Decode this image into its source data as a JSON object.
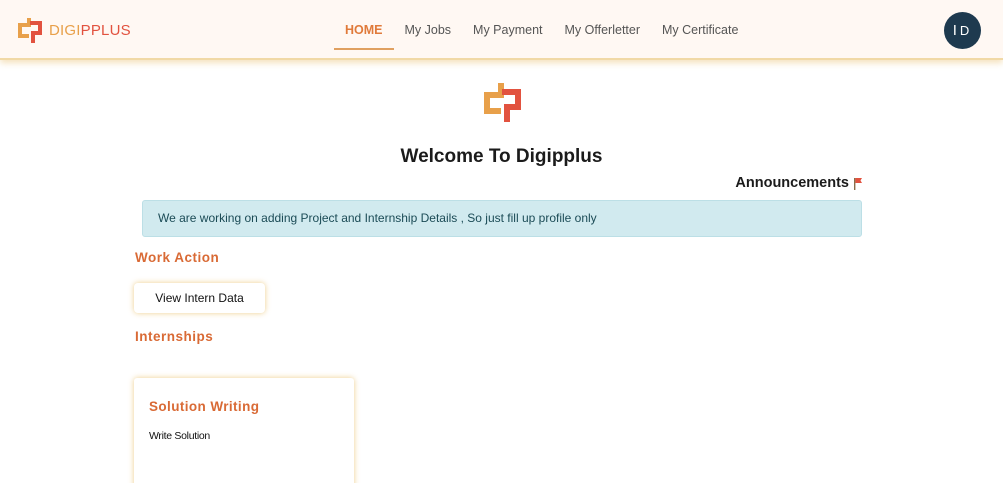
{
  "brand": {
    "name_part1": "DIGI",
    "name_part2": "PPLUS",
    "logo_icon": "dp-logo-icon"
  },
  "nav": {
    "items": [
      {
        "label": "HOME",
        "active": true
      },
      {
        "label": "My Jobs",
        "active": false
      },
      {
        "label": "My Payment",
        "active": false
      },
      {
        "label": "My Offerletter",
        "active": false
      },
      {
        "label": "My Certificate",
        "active": false
      }
    ]
  },
  "user": {
    "initial1": "I",
    "initial2": "D"
  },
  "main": {
    "welcome": "Welcome To Digipplus",
    "announcements_label": "Announcements",
    "announcement_icon": "flag-icon",
    "alert_text": "We are working on adding Project and Internship Details , So just fill up profile only",
    "work_action_title": "Work Action",
    "view_intern_button": "View Intern Data",
    "internships_title": "Internships",
    "internship_cards": [
      {
        "title": "Solution Writing",
        "description": "Write Solution"
      }
    ]
  },
  "colors": {
    "accent_orange": "#d96a35",
    "logo_orange": "#e8a04a",
    "logo_red": "#e2523f",
    "alert_bg": "#d1eaef",
    "avatar_bg": "#1e3a4f"
  }
}
